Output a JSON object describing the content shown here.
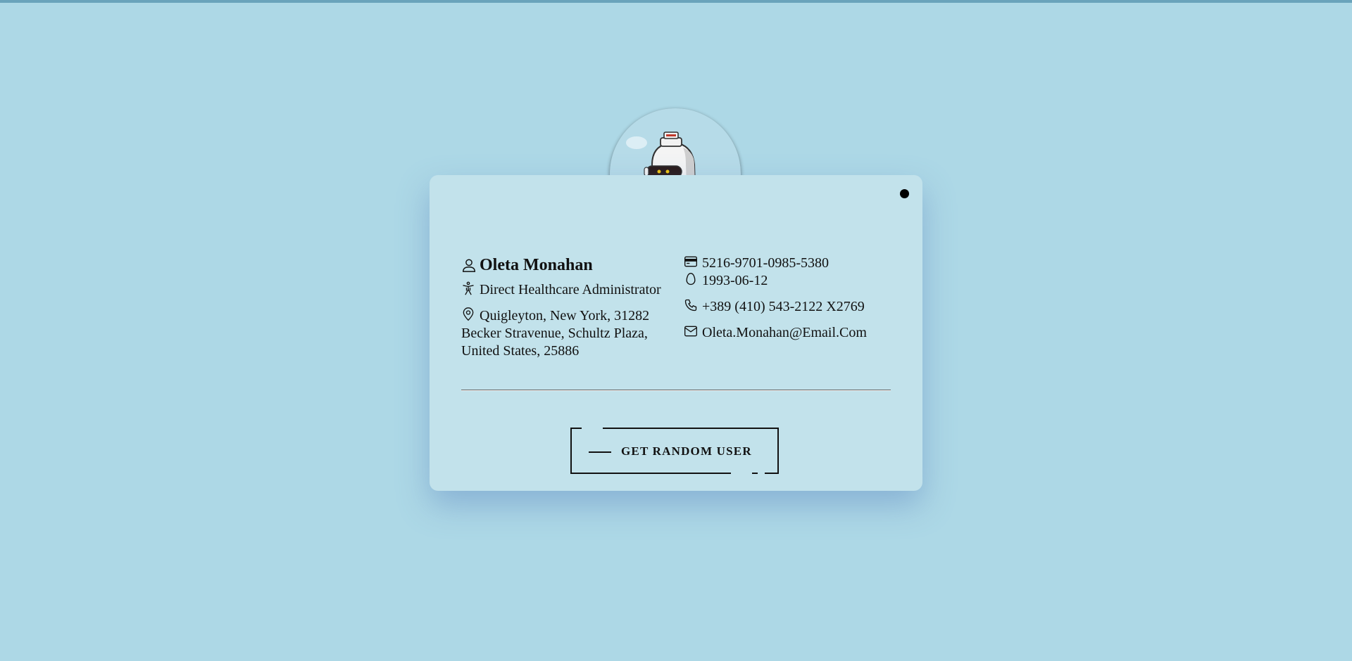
{
  "user": {
    "name": "Oleta Monahan",
    "job": "Direct Healthcare Administrator",
    "address": "Quigleyton, New York, 31282 Becker Stravenue, Schultz Plaza, United States, 25886",
    "card_number": "5216-9701-0985-5380",
    "birthdate": "1993-06-12",
    "phone": "+389 (410) 543-2122 X2769",
    "email": "Oleta.Monahan@Email.Com"
  },
  "action": {
    "button_label": "GET RANDOM USER"
  },
  "icons": {
    "name": "user-icon",
    "job": "accessibility-person-icon",
    "address": "map-pin-icon",
    "card": "credit-card-icon",
    "birthdate": "egg-icon",
    "phone": "phone-icon",
    "email": "mail-icon"
  },
  "colors": {
    "background": "#add8e6",
    "card": "#c2e2eb",
    "text": "#111111"
  }
}
